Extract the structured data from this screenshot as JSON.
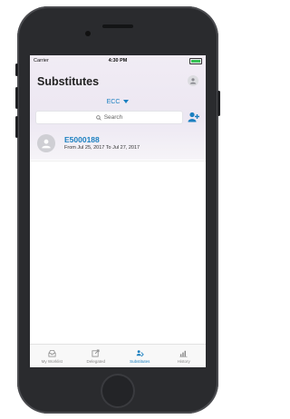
{
  "statusbar": {
    "carrier": "Carrier",
    "time": "4:30 PM"
  },
  "header": {
    "title": "Substitutes"
  },
  "system_select": {
    "value": "ECC"
  },
  "search": {
    "placeholder": "Search"
  },
  "substitutes": [
    {
      "id": "E5000188",
      "dates": "From Jul 25, 2017 To Jul 27, 2017"
    }
  ],
  "tabs": [
    {
      "label": "My Worklist",
      "icon": "inbox-icon"
    },
    {
      "label": "Delegated",
      "icon": "delegated-icon"
    },
    {
      "label": "Substitutes",
      "icon": "substitutes-icon",
      "active": true
    },
    {
      "label": "History",
      "icon": "history-icon"
    }
  ],
  "colors": {
    "accent": "#1a7fc0",
    "battery": "#37c255"
  }
}
